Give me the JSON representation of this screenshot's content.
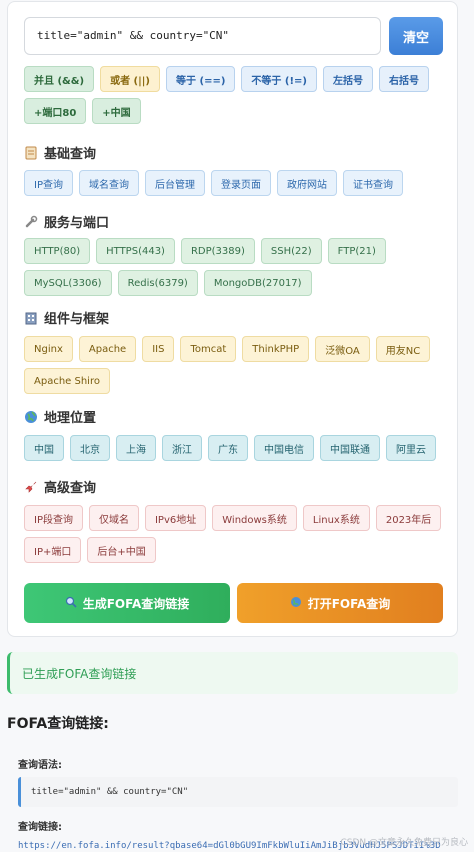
{
  "query": {
    "value": "title=\"admin\" && country=\"CN\""
  },
  "clear_label": "清空",
  "operators": [
    "并且 (&&)",
    "或者 (||)",
    "等于 (==)",
    "不等于 (!=)",
    "左括号",
    "右括号",
    "+端口80",
    "+中国"
  ],
  "sections": {
    "basic": {
      "title": "基础查询",
      "icon": "memo-icon",
      "items": [
        "IP查询",
        "域名查询",
        "后台管理",
        "登录页面",
        "政府网站",
        "证书查询"
      ]
    },
    "service": {
      "title": "服务与端口",
      "icon": "wrench-icon",
      "items": [
        "HTTP(80)",
        "HTTPS(443)",
        "RDP(3389)",
        "SSH(22)",
        "FTP(21)",
        "MySQL(3306)",
        "Redis(6379)",
        "MongoDB(27017)"
      ]
    },
    "framework": {
      "title": "组件与框架",
      "icon": "building-icon",
      "items": [
        "Nginx",
        "Apache",
        "IIS",
        "Tomcat",
        "ThinkPHP",
        "泛微OA",
        "用友NC",
        "Apache Shiro"
      ]
    },
    "geo": {
      "title": "地理位置",
      "icon": "globe-icon",
      "items": [
        "中国",
        "北京",
        "上海",
        "浙江",
        "广东",
        "中国电信",
        "中国联通",
        "阿里云"
      ]
    },
    "advanced": {
      "title": "高级查询",
      "icon": "rocket-icon",
      "items": [
        "IP段查询",
        "仅域名",
        "IPv6地址",
        "Windows系统",
        "Linux系统",
        "2023年后",
        "IP+端口",
        "后台+中国"
      ]
    }
  },
  "buttons": {
    "generate": "生成FOFA查询链接",
    "open": "打开FOFA查询"
  },
  "notice": "已生成FOFA查询链接",
  "result": {
    "title": "FOFA查询链接:",
    "syntax_label": "查询语法:",
    "syntax_value": "title=\"admin\" && country=\"CN\"",
    "link_label": "查询链接:",
    "link_value": "https://en.fofa.info/result?qbase64=dGl0bGU9ImFkbWluIiAmJiBjb3VudHJ5PSJDTiI%3D"
  },
  "watermark": "CSDN @文章永久免费只为良心",
  "colors": {
    "accent_blue": "#3c7fd6",
    "green": "#2fae5c",
    "orange": "#e17f1f"
  }
}
